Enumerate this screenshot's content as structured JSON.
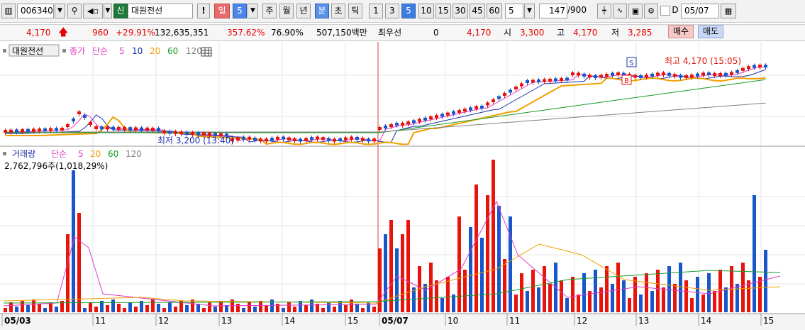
{
  "toolbar": {
    "code": "006340",
    "credit_badge": "신",
    "stock_name": "대원전선",
    "alert": "!",
    "period_day": "일",
    "period_num": "5",
    "period_week": "주",
    "period_month": "월",
    "period_year": "년",
    "period_min": "분",
    "period_sec": "초",
    "period_tick": "틱",
    "intervals": [
      "1",
      "3",
      "5",
      "10",
      "15",
      "30",
      "45",
      "60"
    ],
    "interval_selected": "5",
    "count_select": "5",
    "count_value": "147",
    "count_total": "/900",
    "d_label": "D",
    "date": "05/07"
  },
  "info": {
    "price": "4,170",
    "change": "960",
    "change_rate": "+29.91%",
    "volume": "132,635,351",
    "volume_rate": "357.62%",
    "turnover_rate": "76.90%",
    "amount": "507,150백만",
    "bid_label": "최우선",
    "bid_value": "0",
    "ask_value": "4,170",
    "open_label": "시",
    "open_value": "3,300",
    "high_label": "고",
    "high_value": "4,170",
    "low_label": "저",
    "low_value": "3,285",
    "buy_button": "매수",
    "sell_button": "매도"
  },
  "price_panel": {
    "name": "대원전선",
    "close_label": "종가",
    "ma_label": "단순",
    "ma_periods": [
      "5",
      "10",
      "20",
      "60",
      "120"
    ],
    "high_annotation": "최고 4,170 (15:05)",
    "low_annotation": "최저 3,200 (13:40)",
    "marker_s": "S",
    "marker_b": "B"
  },
  "volume_panel": {
    "label": "거래량",
    "ma_label": "단순",
    "ma_periods": [
      "5",
      "20",
      "60",
      "120"
    ],
    "value": "2,762,796주(1,018,29%)"
  },
  "x_axis": {
    "labels": [
      "05/03",
      "11",
      "12",
      "13",
      "14",
      "15",
      "05/07",
      "10",
      "11",
      "12",
      "13",
      "14",
      "15"
    ]
  },
  "colors": {
    "up": "#e8140c",
    "down": "#1757c9",
    "ma5": "#e23bc8",
    "ma10": "#1b2fa8",
    "ma20": "#f0a000",
    "ma60": "#189a2a",
    "ma120": "#808080"
  }
}
